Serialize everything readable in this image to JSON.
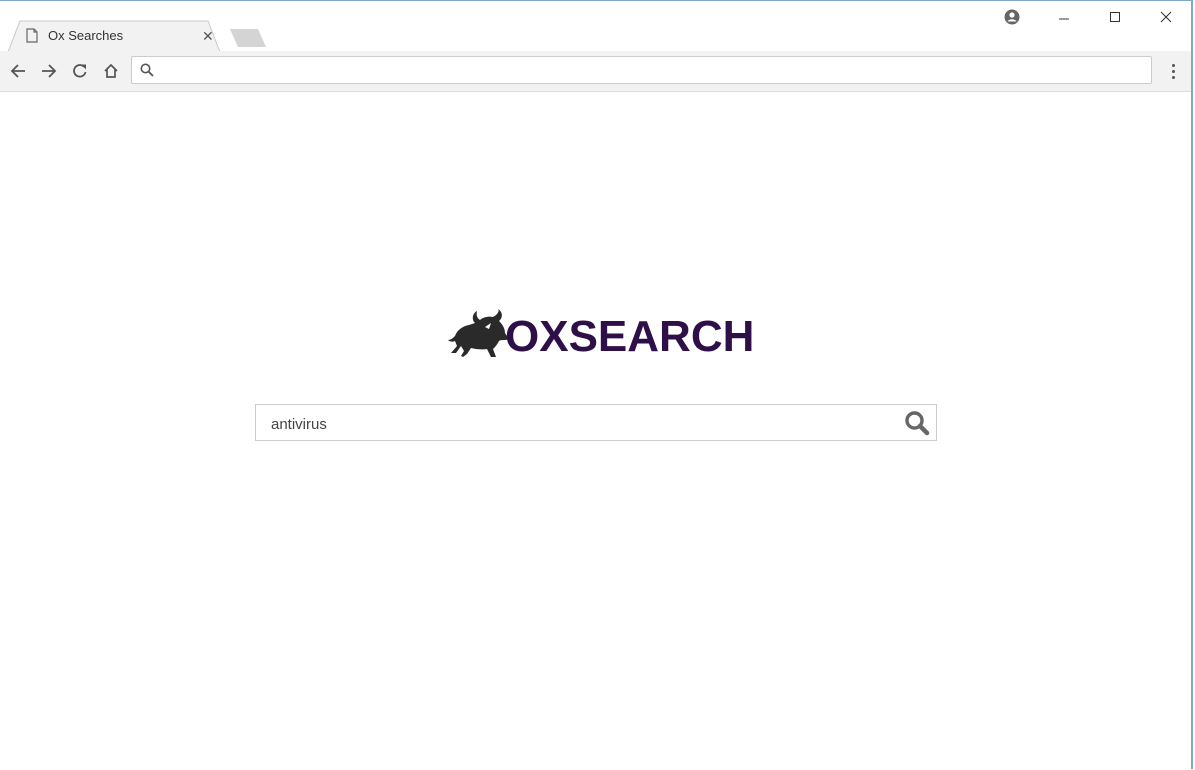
{
  "browser": {
    "tab": {
      "title": "Ox Searches",
      "close_glyph": "✕"
    },
    "window_controls": {
      "minimize": "–",
      "maximize": "☐",
      "close": "✕"
    },
    "omnibox": {
      "value": "",
      "placeholder": ""
    }
  },
  "page": {
    "logo_text": "OXSEARCH",
    "brand_color": "#2e0f47",
    "search": {
      "value": "antivirus",
      "placeholder": ""
    }
  }
}
